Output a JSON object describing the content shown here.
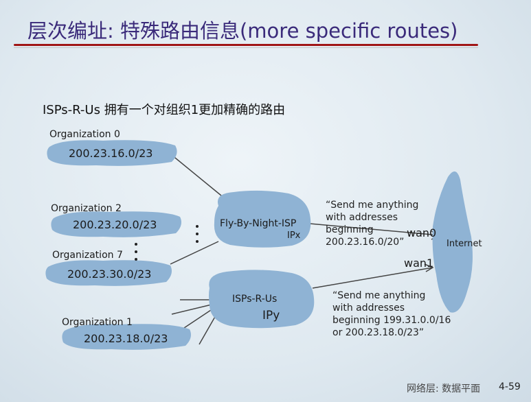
{
  "title": "层次编址: 特殊路由信息(more specific routes)",
  "subtitle": "ISPs-R-Us 拥有一个对组织1更加精确的路由",
  "orgs": [
    {
      "name": "Organization 0",
      "prefix": "200.23.16.0/23"
    },
    {
      "name": "Organization 2",
      "prefix": "200.23.20.0/23"
    },
    {
      "name": "Organization 7",
      "prefix": "200.23.30.0/23"
    },
    {
      "name": "Organization 1",
      "prefix": "200.23.18.0/23"
    }
  ],
  "isp1": {
    "name": "Fly-By-Night-ISP",
    "ip": "IPx"
  },
  "isp2": {
    "name": "ISPs-R-Us",
    "ip": "IPy"
  },
  "ann1": "“Send me anything\nwith addresses\nbeginning\n200.23.16.0/20”",
  "ann2": "“Send me anything\nwith addresses\nbeginning 199.31.0.0/16\nor 200.23.18.0/23”",
  "wan0": "wan0",
  "wan1": "wan1",
  "internet": "Internet",
  "footer": {
    "section": "网络层: 数据平面",
    "page": "4-59"
  },
  "colors": {
    "cloud": "#8fb3d4",
    "title": "#3a2a7a",
    "rule": "#a01515"
  }
}
